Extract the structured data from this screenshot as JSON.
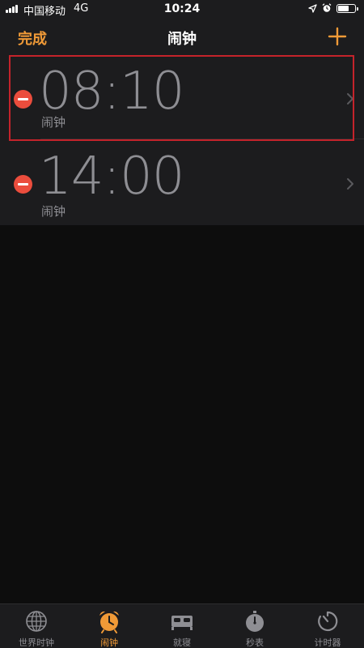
{
  "status_bar": {
    "carrier": "中国移动",
    "network": "4G",
    "time": "10:24",
    "icons": [
      "signal-icon",
      "location-icon",
      "alarm-icon",
      "battery-icon"
    ]
  },
  "nav": {
    "done_label": "完成",
    "title": "闹钟",
    "add_icon": "plus-icon"
  },
  "alarms": [
    {
      "time": "08:10",
      "label": "闹钟"
    },
    {
      "time": "14:00",
      "label": "闹钟"
    }
  ],
  "tabs": [
    {
      "label": "世界时钟",
      "icon": "globe-icon",
      "active": false
    },
    {
      "label": "闹钟",
      "icon": "alarm-clock-icon",
      "active": true
    },
    {
      "label": "就寝",
      "icon": "bed-icon",
      "active": false
    },
    {
      "label": "秒表",
      "icon": "stopwatch-icon",
      "active": false
    },
    {
      "label": "计时器",
      "icon": "timer-icon",
      "active": false
    }
  ],
  "colors": {
    "accent": "#f09a37",
    "delete": "#eb4d3d",
    "highlight_border": "#c4232b",
    "secondary_text": "#8e8e93",
    "background": "#0d0d0d",
    "surface": "#1c1c1e"
  }
}
